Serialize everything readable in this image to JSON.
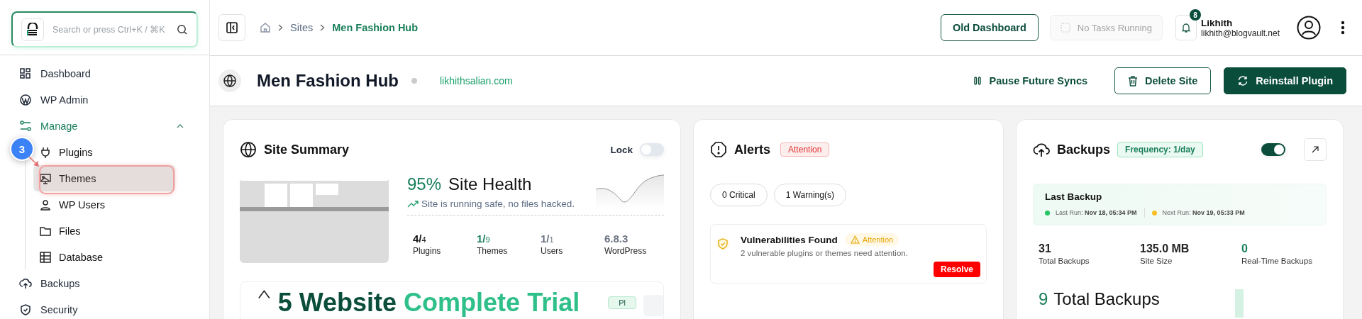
{
  "sidebar": {
    "search": {
      "placeholder": "Search or press Ctrl+K / ⌘K"
    },
    "items": [
      {
        "label": "Dashboard",
        "selected": false
      },
      {
        "label": "WP Admin",
        "selected": false
      },
      {
        "label": "Manage",
        "selected": false,
        "expanded": true,
        "children": [
          {
            "label": "Plugins",
            "selected": false
          },
          {
            "label": "Themes",
            "selected": true
          },
          {
            "label": "WP Users",
            "selected": false
          },
          {
            "label": "Files",
            "selected": false
          },
          {
            "label": "Database",
            "selected": false
          }
        ]
      },
      {
        "label": "Backups",
        "selected": false
      },
      {
        "label": "Security",
        "selected": false
      }
    ],
    "tour": {
      "step": "3"
    }
  },
  "breadcrumb": [
    {
      "label": "Sites",
      "current": false
    },
    {
      "label": "Men Fashion Hub",
      "current": true
    }
  ],
  "topbar": {
    "old_dashboard": "Old Dashboard",
    "tasks": {
      "label": "No Tasks Running",
      "disabled": true
    },
    "notifications": {
      "count": "8"
    },
    "user": {
      "name": "Likhith",
      "email": "likhith@blogvault.net"
    }
  },
  "site": {
    "name": "Men Fashion Hub",
    "url": "likhithsalian.com",
    "actions": [
      {
        "label": "Pause Future Syncs",
        "kind": "link"
      },
      {
        "label": "Delete Site",
        "kind": "outline"
      },
      {
        "label": "Reinstall Plugin",
        "kind": "primary"
      }
    ]
  },
  "site_summary": {
    "title": "Site Summary",
    "lock": {
      "label": "Lock",
      "on": false
    },
    "health": {
      "percent": "95%",
      "label": "Site Health",
      "note": "Site is running safe, no files hacked."
    },
    "stats": [
      {
        "main": "4/",
        "sub": "4",
        "label": "Plugins",
        "color": "#111111"
      },
      {
        "main": "1/",
        "sub": "9",
        "label": "Themes",
        "color": "#1a7f5a"
      },
      {
        "main": "1/",
        "sub": "1",
        "label": "Users",
        "color": "#6b7280"
      },
      {
        "main": "6.8.3",
        "label": "WordPress",
        "color": "#6b7280"
      }
    ],
    "trial": {
      "lead": "5 Website",
      "rest": "Complete Trial",
      "badge": "Pl"
    }
  },
  "alerts": {
    "title": "Alerts",
    "badge": "Attention",
    "chips": [
      "0 Critical",
      "1 Warning(s)"
    ],
    "items": [
      {
        "title": "Vulnerabilities Found",
        "badge": "Attention",
        "description": "2 vulnerable plugins or themes need attention.",
        "action": "Resolve"
      }
    ]
  },
  "backups": {
    "title": "Backups",
    "frequency": "Frequency: 1/day",
    "enabled": true,
    "last_backup": {
      "title": "Last Backup",
      "runs": [
        {
          "text": "Last Run: **Nov 18, 05:34 PM**",
          "color": "#22c55e"
        },
        {
          "text": "Next Run: **Nov 19, 05:33 PM**",
          "color": "#fbbf24"
        }
      ]
    },
    "stats": [
      {
        "value": "31",
        "label": "Total Backups",
        "color": "#222222"
      },
      {
        "value": "135.0 MB",
        "label": "Site Size",
        "color": "#222222"
      },
      {
        "value": "0",
        "label": "Real-Time Backups",
        "color": "#1a7f5a"
      }
    ],
    "total": {
      "count": "9",
      "label": "Total Backups"
    }
  }
}
